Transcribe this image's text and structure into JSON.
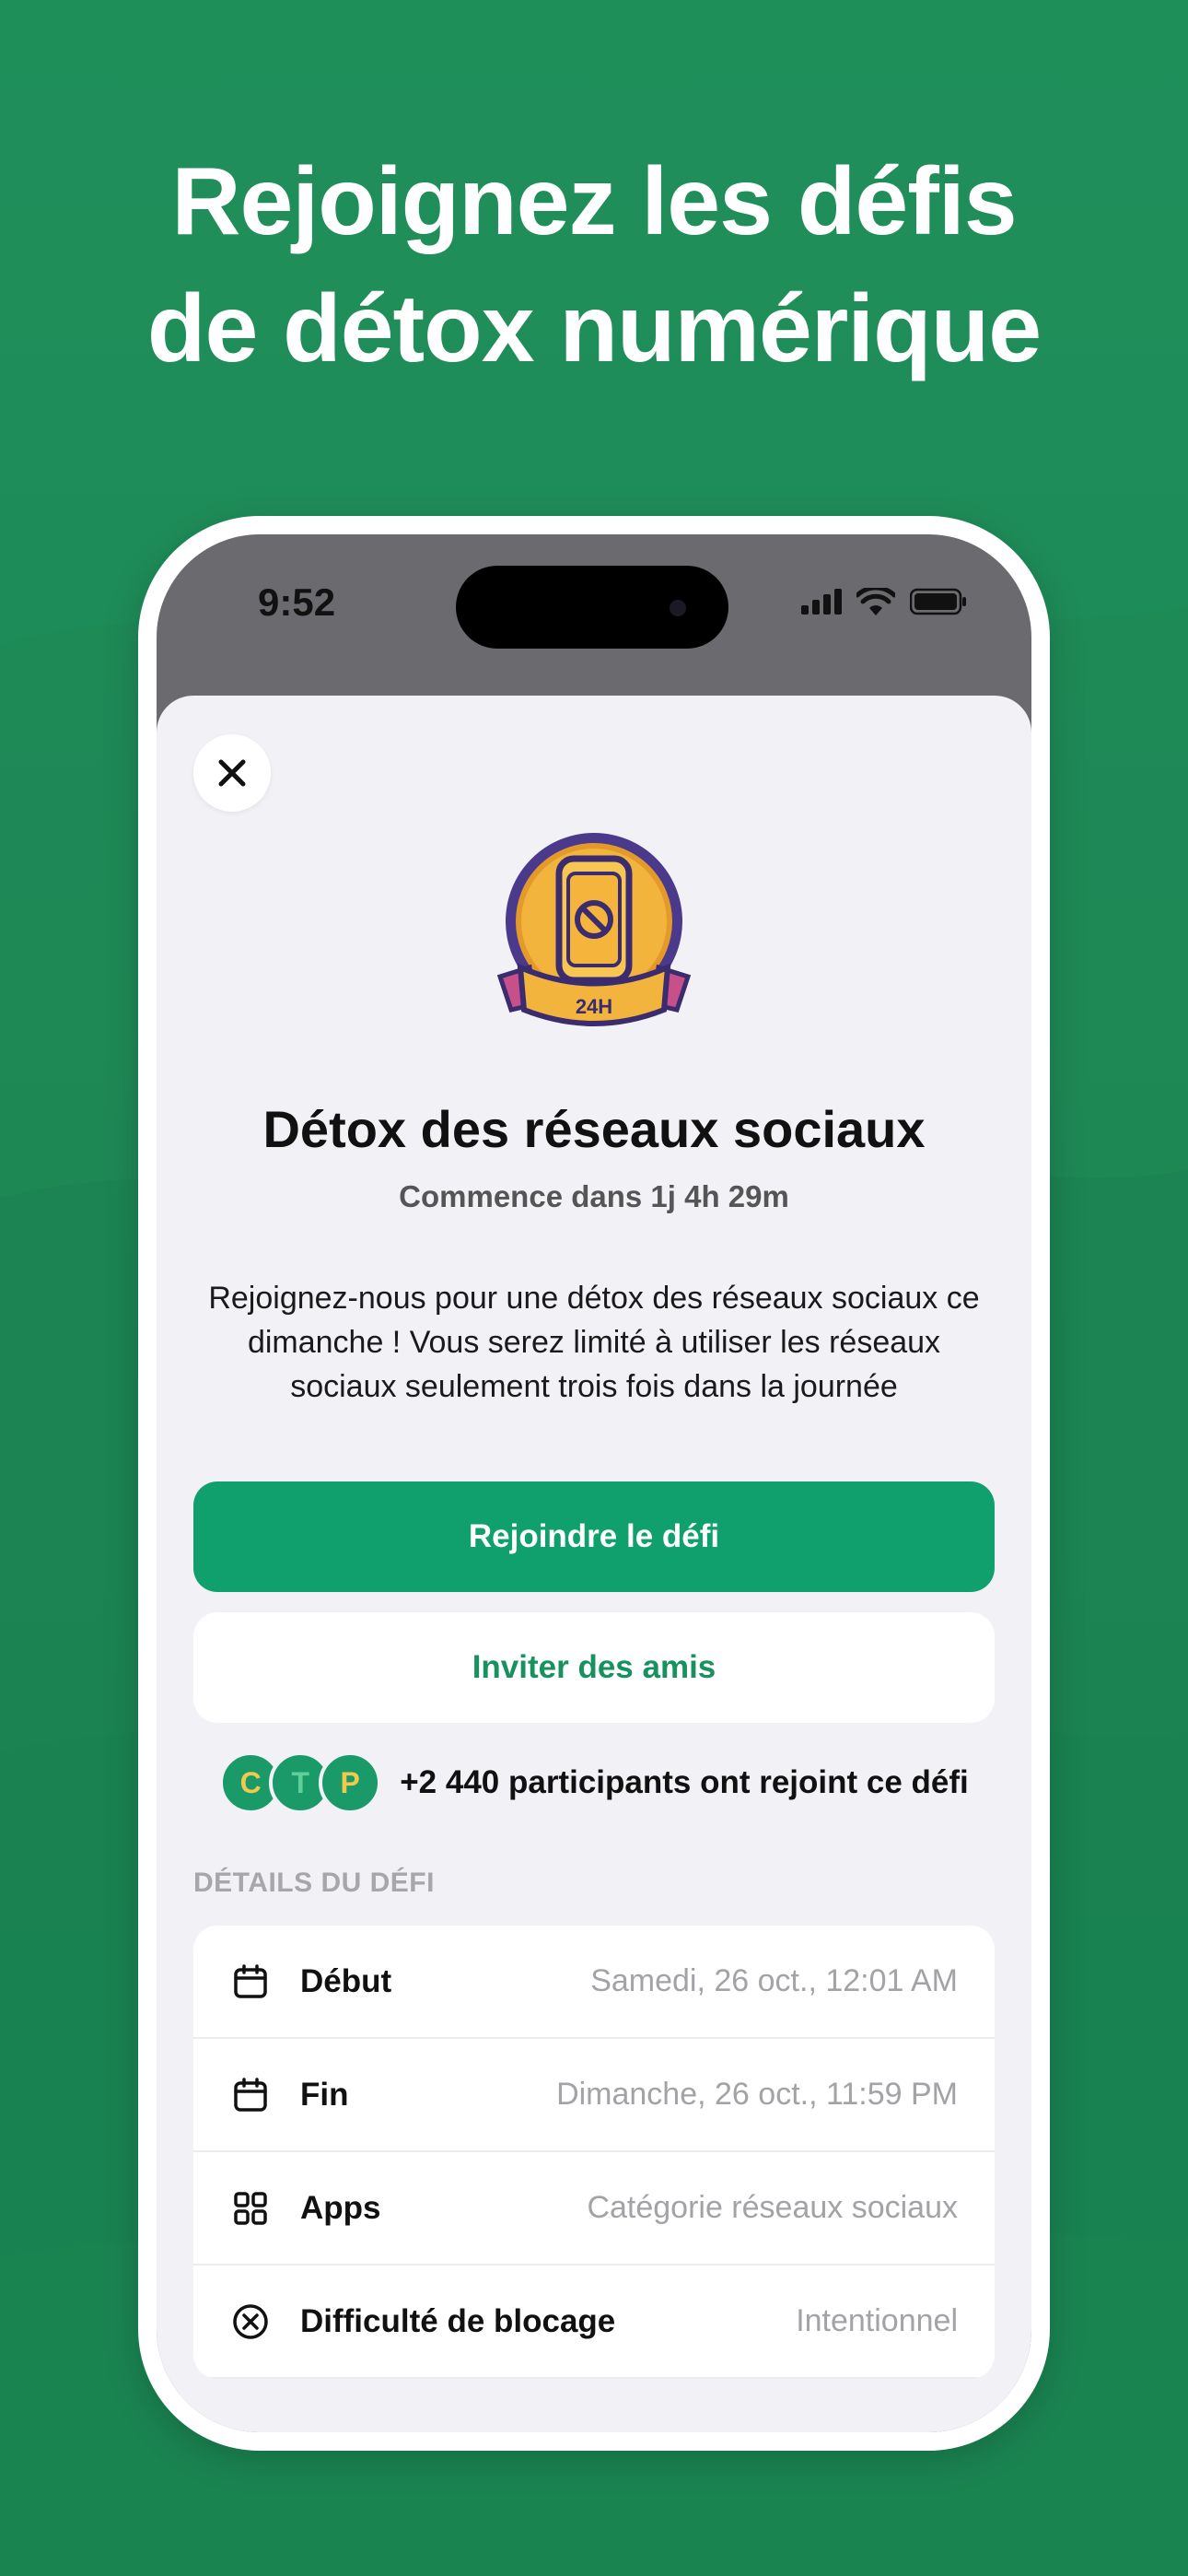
{
  "headline": {
    "line1": "Rejoignez les défis",
    "line2": "de détox numérique"
  },
  "statusbar": {
    "time": "9:52"
  },
  "badge": {
    "label": "24H"
  },
  "challenge": {
    "title": "Détox des réseaux sociaux",
    "subtitle": "Commence dans 1j 4h 29m",
    "description": "Rejoignez-nous pour une détox des réseaux sociaux ce dimanche ! Vous serez limité à utiliser les réseaux sociaux seulement trois fois dans la journée"
  },
  "buttons": {
    "join": "Rejoindre le défi",
    "invite": "Inviter des amis"
  },
  "participants": {
    "avatars": [
      "C",
      "T",
      "P"
    ],
    "text": "+2 440 participants ont rejoint ce défi"
  },
  "details": {
    "section_label": "DÉTAILS DU DÉFI",
    "rows": [
      {
        "label": "Début",
        "value": "Samedi, 26 oct., 12:01 AM",
        "icon": "calendar-icon"
      },
      {
        "label": "Fin",
        "value": "Dimanche, 26 oct., 11:59 PM",
        "icon": "calendar-icon"
      },
      {
        "label": "Apps",
        "value": "Catégorie réseaux sociaux",
        "icon": "apps-grid-icon"
      },
      {
        "label": "Difficulté de blocage",
        "value": "Intentionnel",
        "icon": "circle-x-icon"
      }
    ]
  },
  "colors": {
    "background_green": "#1e8a57",
    "primary_button": "#10a06e",
    "accent_text": "#17925f",
    "badge_gold": "#f2b43c",
    "badge_purple": "#4b3a8c"
  }
}
